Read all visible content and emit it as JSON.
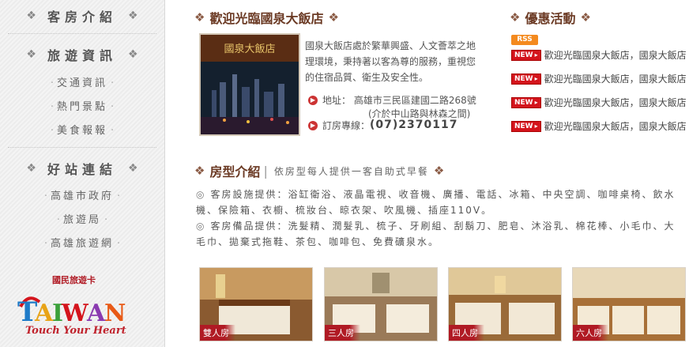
{
  "sidebar": {
    "sections": [
      {
        "title": "客房介紹",
        "items": []
      },
      {
        "title": "旅遊資訊",
        "items": [
          "交通資訊",
          "熱門景點",
          "美食報報"
        ]
      },
      {
        "title": "好站連結",
        "items": [
          "高雄市政府",
          "旅遊局",
          "高雄旅遊網"
        ]
      }
    ],
    "logo": {
      "caption": "國民旅遊卡",
      "word": "TAIWAN",
      "tagline": "Touch Your Heart"
    }
  },
  "welcome": {
    "title": "歡迎光臨國泉大飯店",
    "sign_text": "國泉大飯店",
    "intro": "國泉大飯店處於繁華興盛、人文薈萃之地理環境，秉持著以客為尊的服務，重視您的住宿品質、衛生及安全性。",
    "address_label": "地址：",
    "address": "高雄市三民區建國二路268號",
    "address_note": "(介於中山路與林森之間)",
    "phone_label": "訂房專線：",
    "phone": "(07)2370117"
  },
  "promo": {
    "title": "優惠活動",
    "rss_label": "RSS",
    "new_badge": "NEW",
    "items": [
      "歡迎光臨國泉大飯店，國泉大飯店",
      "歡迎光臨國泉大飯店，國泉大飯店",
      "歡迎光臨國泉大飯店，國泉大飯店",
      "歡迎光臨國泉大飯店，國泉大飯店"
    ]
  },
  "rooms": {
    "title": "房型介紹",
    "subtitle": "依房型每人提供一客自助式早餐",
    "facilities": "客房設施提供：浴缸衛浴、液晶電視、收音機、廣播、電話、冰箱、中央空調、咖啡桌椅、飲水機、保險箱、衣櫥、梳妝台、晾衣架、吹風機、插座110V。",
    "amenities": "客房備品提供：洗髮精、潤髮乳、梳子、牙刷組、刮鬍刀、肥皂、沐浴乳、棉花棒、小毛巾、大毛巾、拋棄式拖鞋、茶包、咖啡包、免費礦泉水。",
    "types": [
      "雙人房",
      "三人房",
      "四人房",
      "六人房"
    ]
  },
  "colors": {
    "accent": "#b01a24",
    "title": "#6b3a24",
    "rss": "#f48a1e"
  }
}
